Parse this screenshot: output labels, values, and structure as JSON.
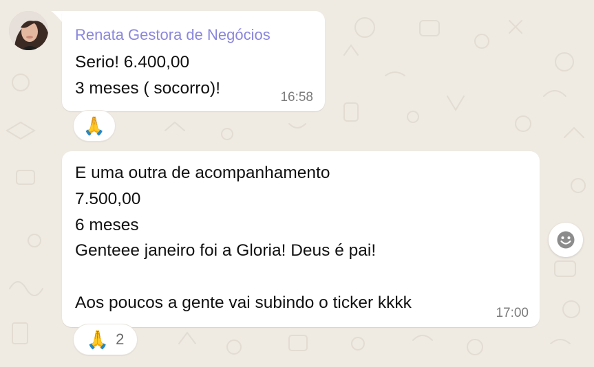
{
  "colors": {
    "background": "#efeae2",
    "bubble": "#ffffff",
    "sender_name": "#8a86dc",
    "text": "#111111",
    "time": "#7b7b7b"
  },
  "messages": [
    {
      "sender": "Renata Gestora de Negócios",
      "text": "Serio! 6.400,00\n3 meses ( socorro)!",
      "time": "16:58",
      "reaction": {
        "emoji": "🙏",
        "count": ""
      }
    },
    {
      "text": "E uma outra de acompanhamento\n7.500,00\n6 meses\nGenteee janeiro foi a Gloria! Deus é pai!\n\nAos poucos a gente vai subindo o ticker kkkk",
      "time": "17:00",
      "reaction": {
        "emoji": "🙏",
        "count": "2"
      }
    }
  ],
  "icons": {
    "avatar": "user-avatar-photo",
    "emoji_picker": "smiley-face-icon"
  }
}
